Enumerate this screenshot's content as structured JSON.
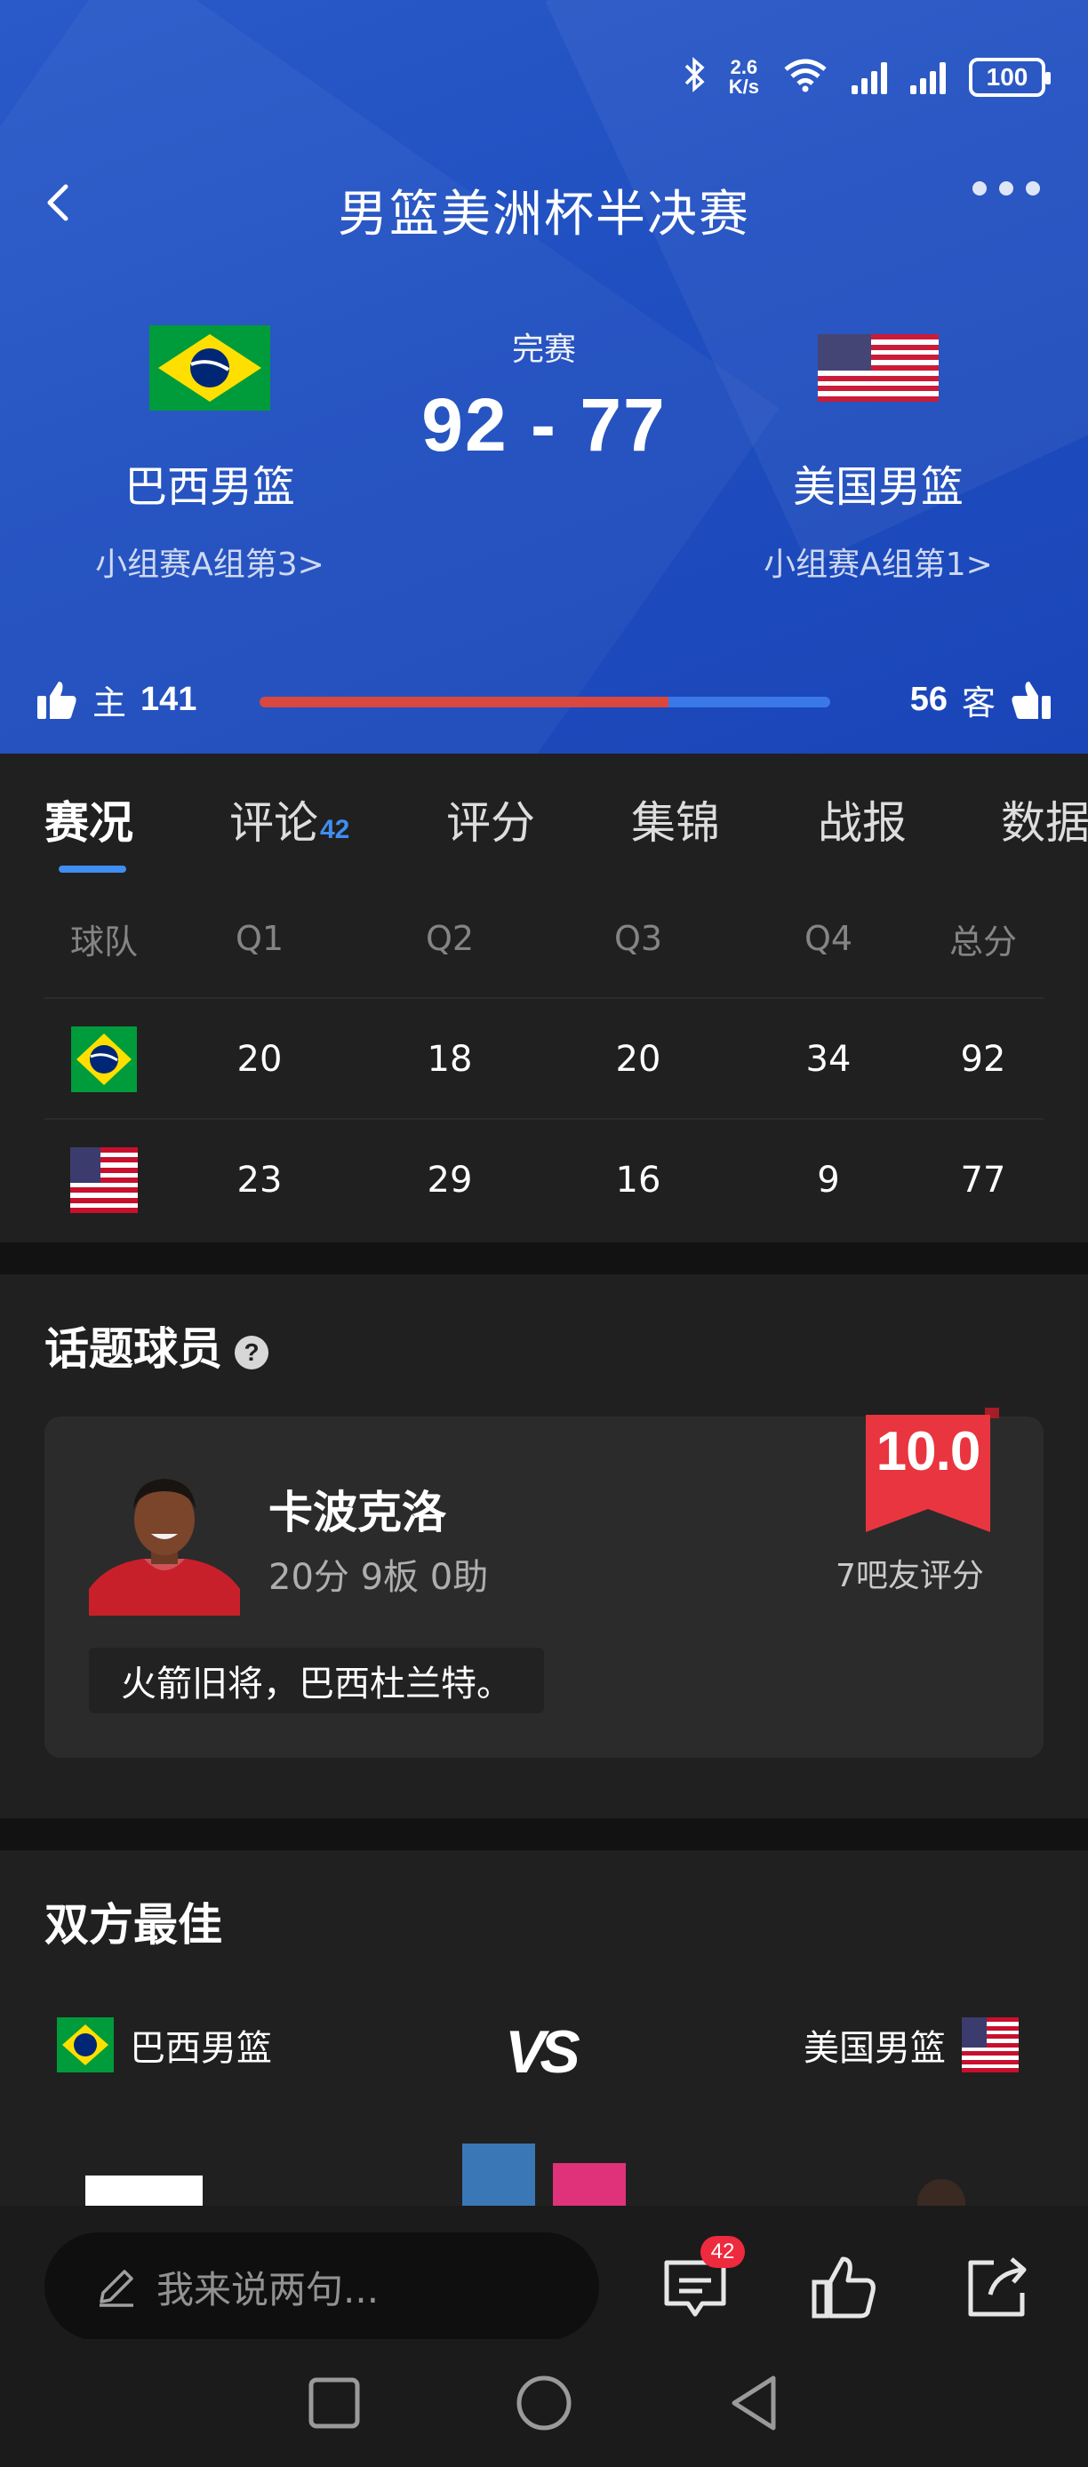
{
  "status_bar": {
    "speed_top": "2.6",
    "speed_unit": "K/s",
    "battery": "100"
  },
  "header": {
    "title": "男篮美洲杯半决赛"
  },
  "match": {
    "status": "完赛",
    "score": "92 - 77",
    "home": {
      "name": "巴西男篮",
      "group": "小组赛A组第3>"
    },
    "away": {
      "name": "美国男篮",
      "group": "小组赛A组第1>"
    }
  },
  "likes": {
    "home_label": "主",
    "home_count": "141",
    "away_count": "56",
    "away_label": "客",
    "home_share": 0.716
  },
  "tabs": [
    {
      "label": "赛况"
    },
    {
      "label": "评论",
      "badge": "42"
    },
    {
      "label": "评分"
    },
    {
      "label": "集锦"
    },
    {
      "label": "战报"
    },
    {
      "label": "数据"
    }
  ],
  "score_table": {
    "headers": [
      "球队",
      "Q1",
      "Q2",
      "Q3",
      "Q4",
      "总分"
    ],
    "rows": [
      {
        "team": "brazil",
        "q1": "20",
        "q2": "18",
        "q3": "20",
        "q4": "34",
        "total": "92"
      },
      {
        "team": "usa",
        "q1": "23",
        "q2": "29",
        "q3": "16",
        "q4": "9",
        "total": "77"
      }
    ]
  },
  "topic_player": {
    "section_title": "话题球员",
    "help": "?",
    "name": "卡波克洛",
    "stats": "20分 9板 0助",
    "rating": "10.0",
    "rating_meta": "7吧友评分",
    "quote": "火箭旧将，巴西杜兰特。"
  },
  "best_players": {
    "section_title": "双方最佳",
    "home_team": "巴西男篮",
    "away_team": "美国男篮",
    "vs": "VS"
  },
  "bottom_bar": {
    "placeholder": "我来说两句...",
    "comment_badge": "42"
  },
  "colors": {
    "accent": "#3f8ef0",
    "home_bar": "#d9473f",
    "away_bar": "#3a78e8",
    "rating_red": "#e8353f"
  }
}
